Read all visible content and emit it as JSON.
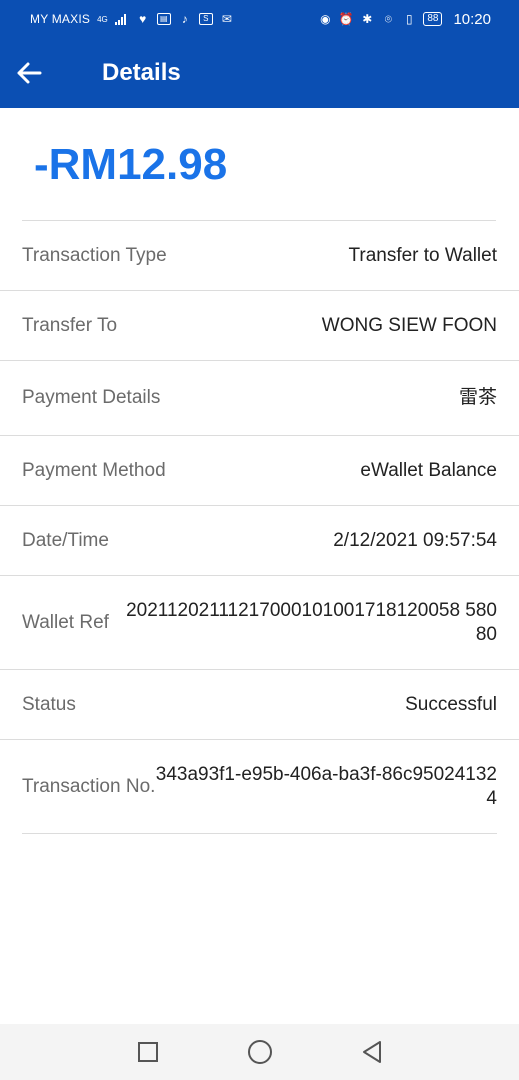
{
  "status_bar": {
    "carrier": "MY MAXIS",
    "network": "4G",
    "battery": "88",
    "time": "10:20"
  },
  "header": {
    "title": "Details",
    "back_icon": "arrow-left-icon"
  },
  "transaction": {
    "amount": "-RM12.98",
    "rows": [
      {
        "label": "Transaction Type",
        "value": "Transfer to Wallet"
      },
      {
        "label": "Transfer To",
        "value": "WONG SIEW FOON"
      },
      {
        "label": "Payment Details",
        "value": "雷茶"
      },
      {
        "label": "Payment Method",
        "value": "eWallet Balance"
      },
      {
        "label": "Date/Time",
        "value": "2/12/2021 09:57:54"
      },
      {
        "label": "Wallet Ref",
        "value": "20211202111217000101001718120058 58080"
      },
      {
        "label": "Status",
        "value": "Successful"
      },
      {
        "label": "Transaction No.",
        "value": "343a93f1-e95b-406a-ba3f-86c950241324"
      }
    ]
  },
  "colors": {
    "header_bg": "#0b4fb3",
    "amount": "#1a73e8",
    "label": "#6b6b6b",
    "value": "#222222"
  },
  "nav_bar": {
    "icons": [
      "recent-apps-icon",
      "home-icon",
      "back-triangle-icon"
    ]
  }
}
